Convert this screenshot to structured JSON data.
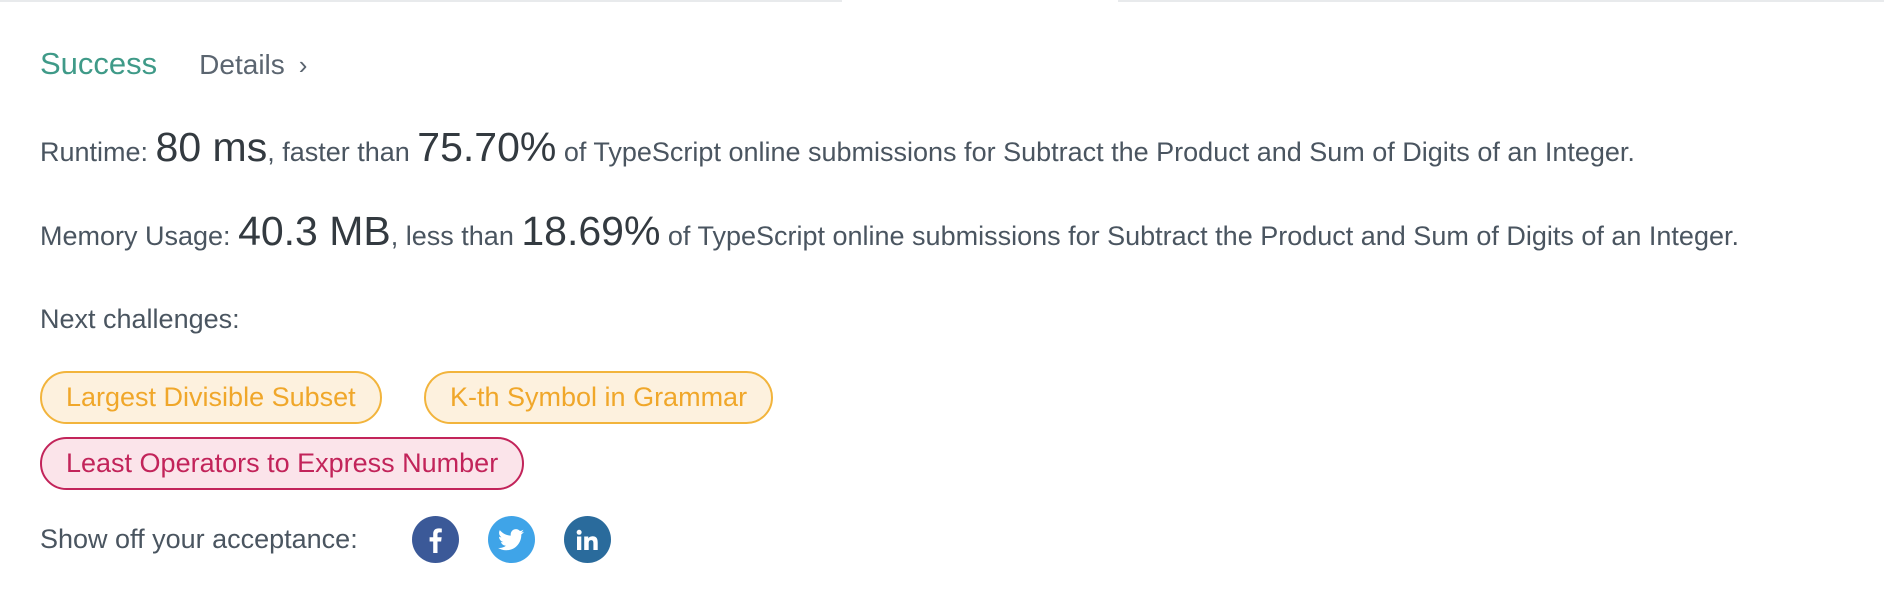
{
  "header": {
    "status": "Success",
    "details_label": "Details",
    "details_chevron": "›"
  },
  "runtime": {
    "label": "Runtime: ",
    "value": "80 ms",
    "comparison": ", faster than ",
    "percent": "75.70%",
    "suffix": " of TypeScript online submissions for Subtract the Product and Sum of Digits of an Integer."
  },
  "memory": {
    "label": "Memory Usage: ",
    "value": "40.3 MB",
    "comparison": ", less than ",
    "percent": "18.69%",
    "suffix": " of TypeScript online submissions for Subtract the Product and Sum of Digits of an Integer."
  },
  "next_challenges": {
    "label": "Next challenges:",
    "items": [
      {
        "label": "Largest Divisible Subset",
        "difficulty": "medium"
      },
      {
        "label": "K-th Symbol in Grammar",
        "difficulty": "medium"
      },
      {
        "label": "Least Operators to Express Number",
        "difficulty": "hard"
      }
    ]
  },
  "share": {
    "label": "Show off your acceptance:",
    "icons": [
      "facebook-icon",
      "twitter-icon",
      "linkedin-icon"
    ]
  },
  "colors": {
    "success": "#3f9a88",
    "medium": "#f0a72a",
    "hard": "#c2245a",
    "facebook": "#3b5998",
    "twitter": "#3fa4e8",
    "linkedin": "#2a6b9c"
  }
}
